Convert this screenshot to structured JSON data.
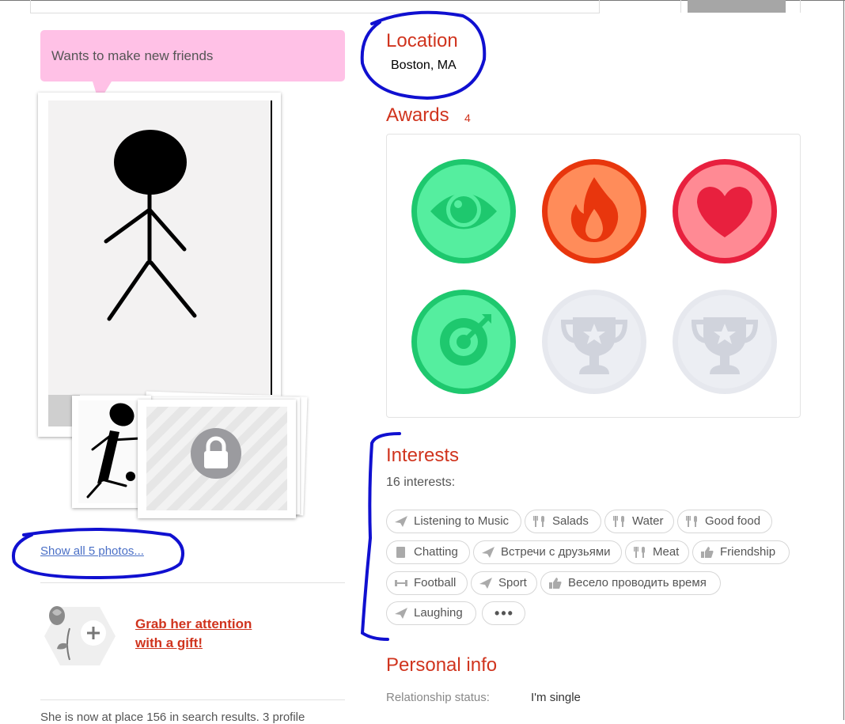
{
  "status": {
    "text": "Wants to make new friends"
  },
  "photos": {
    "show_all_label": "Show all 5 photos..."
  },
  "gift": {
    "line1": "Grab her attention",
    "line2": "with a gift!"
  },
  "footer": {
    "text": "She is now at place 156 in search results. 3 profile"
  },
  "location": {
    "heading": "Location",
    "value": "Boston, MA"
  },
  "awards": {
    "heading": "Awards",
    "count": "4",
    "items": [
      {
        "icon": "eye-icon",
        "state": "earned",
        "color": "#1ec86e"
      },
      {
        "icon": "flame-icon",
        "state": "earned",
        "color": "#e8360d"
      },
      {
        "icon": "heart-icon",
        "state": "earned",
        "color": "#e8203e"
      },
      {
        "icon": "target-icon",
        "state": "earned",
        "color": "#1ec86e"
      },
      {
        "icon": "trophy-icon",
        "state": "locked",
        "color": "#e6e8ee"
      },
      {
        "icon": "trophy-icon",
        "state": "locked",
        "color": "#e6e8ee"
      }
    ]
  },
  "interests": {
    "heading": "Interests",
    "count_label": "16 interests:",
    "tags": [
      {
        "label": "Listening to Music",
        "icon": "plane-icon"
      },
      {
        "label": "Salads",
        "icon": "fork-knife-icon"
      },
      {
        "label": "Water",
        "icon": "fork-knife-icon"
      },
      {
        "label": "Good food",
        "icon": "fork-knife-icon"
      },
      {
        "label": "Chatting",
        "icon": "cup-icon"
      },
      {
        "label": "Встречи с друзьями",
        "icon": "plane-icon"
      },
      {
        "label": "Meat",
        "icon": "fork-knife-icon"
      },
      {
        "label": "Friendship",
        "icon": "thumbs-up-icon"
      },
      {
        "label": "Football",
        "icon": "dumbbell-icon"
      },
      {
        "label": "Sport",
        "icon": "plane-icon"
      },
      {
        "label": "Весело проводить время",
        "icon": "thumbs-up-icon"
      },
      {
        "label": "Laughing",
        "icon": "plane-icon"
      }
    ],
    "more_label": "•••"
  },
  "personal": {
    "heading": "Personal info",
    "relationship_label": "Relationship status:",
    "relationship_value": "I'm single"
  },
  "colors": {
    "accent": "#d0341e",
    "link": "#4a6fc6",
    "bubble": "#ffc1e6",
    "annotation": "#1010d0"
  }
}
